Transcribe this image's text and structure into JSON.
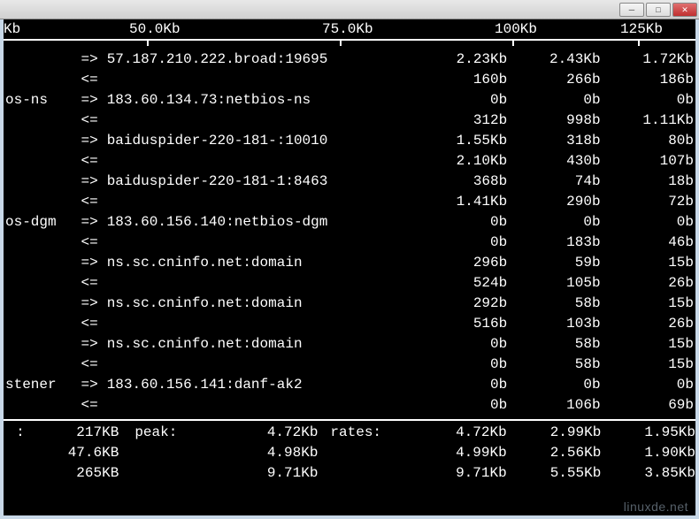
{
  "window": {
    "min_label": "─",
    "max_label": "□",
    "close_label": "✕"
  },
  "scale": {
    "ticks": [
      "Kb",
      "50.0Kb",
      "75.0Kb",
      "100Kb",
      "125Kb"
    ],
    "positions": [
      0,
      142,
      360,
      555,
      697
    ]
  },
  "flows": [
    {
      "left": "",
      "dir": "=>",
      "host": "57.187.210.222.broad:19695",
      "a": "2.23Kb",
      "b": "2.43Kb",
      "c": "1.72Kb"
    },
    {
      "left": "",
      "dir": "<=",
      "host": "",
      "a": "160b",
      "b": "266b",
      "c": "186b"
    },
    {
      "left": "os-ns",
      "dir": "=>",
      "host": "183.60.134.73:netbios-ns",
      "a": "0b",
      "b": "0b",
      "c": "0b"
    },
    {
      "left": "",
      "dir": "<=",
      "host": "",
      "a": "312b",
      "b": "998b",
      "c": "1.11Kb"
    },
    {
      "left": "",
      "dir": "=>",
      "host": "baiduspider-220-181-:10010",
      "a": "1.55Kb",
      "b": "318b",
      "c": "80b"
    },
    {
      "left": "",
      "dir": "<=",
      "host": "",
      "a": "2.10Kb",
      "b": "430b",
      "c": "107b"
    },
    {
      "left": "",
      "dir": "=>",
      "host": "baiduspider-220-181-1:8463",
      "a": "368b",
      "b": "74b",
      "c": "18b"
    },
    {
      "left": "",
      "dir": "<=",
      "host": "",
      "a": "1.41Kb",
      "b": "290b",
      "c": "72b"
    },
    {
      "left": "os-dgm",
      "dir": "=>",
      "host": "183.60.156.140:netbios-dgm",
      "a": "0b",
      "b": "0b",
      "c": "0b"
    },
    {
      "left": "",
      "dir": "<=",
      "host": "",
      "a": "0b",
      "b": "183b",
      "c": "46b"
    },
    {
      "left": "",
      "dir": "=>",
      "host": "ns.sc.cninfo.net:domain",
      "a": "296b",
      "b": "59b",
      "c": "15b"
    },
    {
      "left": "",
      "dir": "<=",
      "host": "",
      "a": "524b",
      "b": "105b",
      "c": "26b"
    },
    {
      "left": "",
      "dir": "=>",
      "host": "ns.sc.cninfo.net:domain",
      "a": "292b",
      "b": "58b",
      "c": "15b"
    },
    {
      "left": "",
      "dir": "<=",
      "host": "",
      "a": "516b",
      "b": "103b",
      "c": "26b"
    },
    {
      "left": "",
      "dir": "=>",
      "host": "ns.sc.cninfo.net:domain",
      "a": "0b",
      "b": "58b",
      "c": "15b"
    },
    {
      "left": "",
      "dir": "<=",
      "host": "",
      "a": "0b",
      "b": "58b",
      "c": "15b"
    },
    {
      "left": "stener",
      "dir": "=>",
      "host": "183.60.156.141:danf-ak2",
      "a": "0b",
      "b": "0b",
      "c": "0b"
    },
    {
      "left": "",
      "dir": "<=",
      "host": "",
      "a": "0b",
      "b": "106b",
      "c": "69b"
    }
  ],
  "stats": {
    "label_colon": ":",
    "peak_label": "peak:",
    "rates_label": "rates:",
    "rows": [
      {
        "cum": "217KB",
        "peak": "4.72Kb",
        "r1": "4.72Kb",
        "r2": "2.99Kb",
        "r3": "1.95Kb"
      },
      {
        "cum": "47.6KB",
        "peak": "4.98Kb",
        "r1": "4.99Kb",
        "r2": "2.56Kb",
        "r3": "1.90Kb"
      },
      {
        "cum": "265KB",
        "peak": "9.71Kb",
        "r1": "9.71Kb",
        "r2": "5.55Kb",
        "r3": "3.85Kb"
      }
    ]
  },
  "watermark": "linuxde.net"
}
